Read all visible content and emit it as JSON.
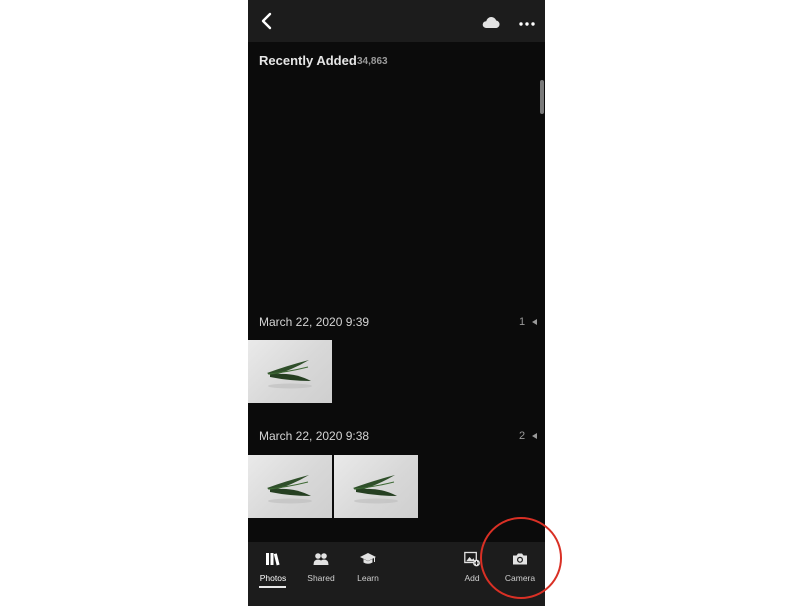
{
  "header": {
    "back_icon": "chevron-left-icon",
    "cloud_icon": "cloud-icon",
    "more_icon": "more-horizontal-icon"
  },
  "album": {
    "title": "Recently Added",
    "count": "34,863"
  },
  "sections": [
    {
      "date": "March 22, 2020 9:39",
      "count": "1",
      "photos": 1
    },
    {
      "date": "March 22, 2020 9:38",
      "count": "2",
      "photos": 2
    }
  ],
  "tabs": {
    "photos": "Photos",
    "shared": "Shared",
    "learn": "Learn",
    "add": "Add",
    "camera": "Camera"
  },
  "active_tab": "Photos",
  "colors": {
    "background": "#0b0b0b",
    "bar": "#1c1c1c",
    "highlight": "#d93025"
  }
}
